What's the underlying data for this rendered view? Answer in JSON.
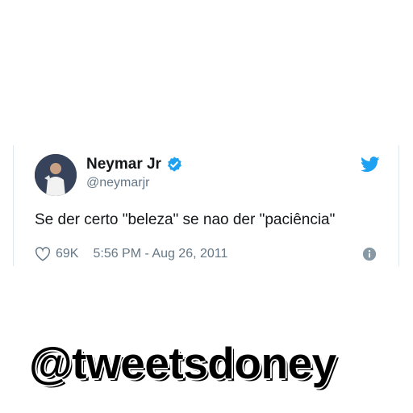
{
  "tweet": {
    "author_name": "Neymar Jr",
    "author_handle": "@neymarjr",
    "text": "Se der certo \"beleza\" se nao der \"paciência\"",
    "likes": "69K",
    "timestamp": "5:56 PM - Aug 26, 2011"
  },
  "icons": {
    "verified": "verified-badge-icon",
    "twitter": "twitter-bird-icon",
    "like": "heart-icon",
    "info": "info-icon"
  },
  "colors": {
    "accent": "#1da1f2",
    "text": "#14171a",
    "muted": "#657786",
    "border": "#e1e8ed"
  },
  "watermark": "@tweetsdoney"
}
